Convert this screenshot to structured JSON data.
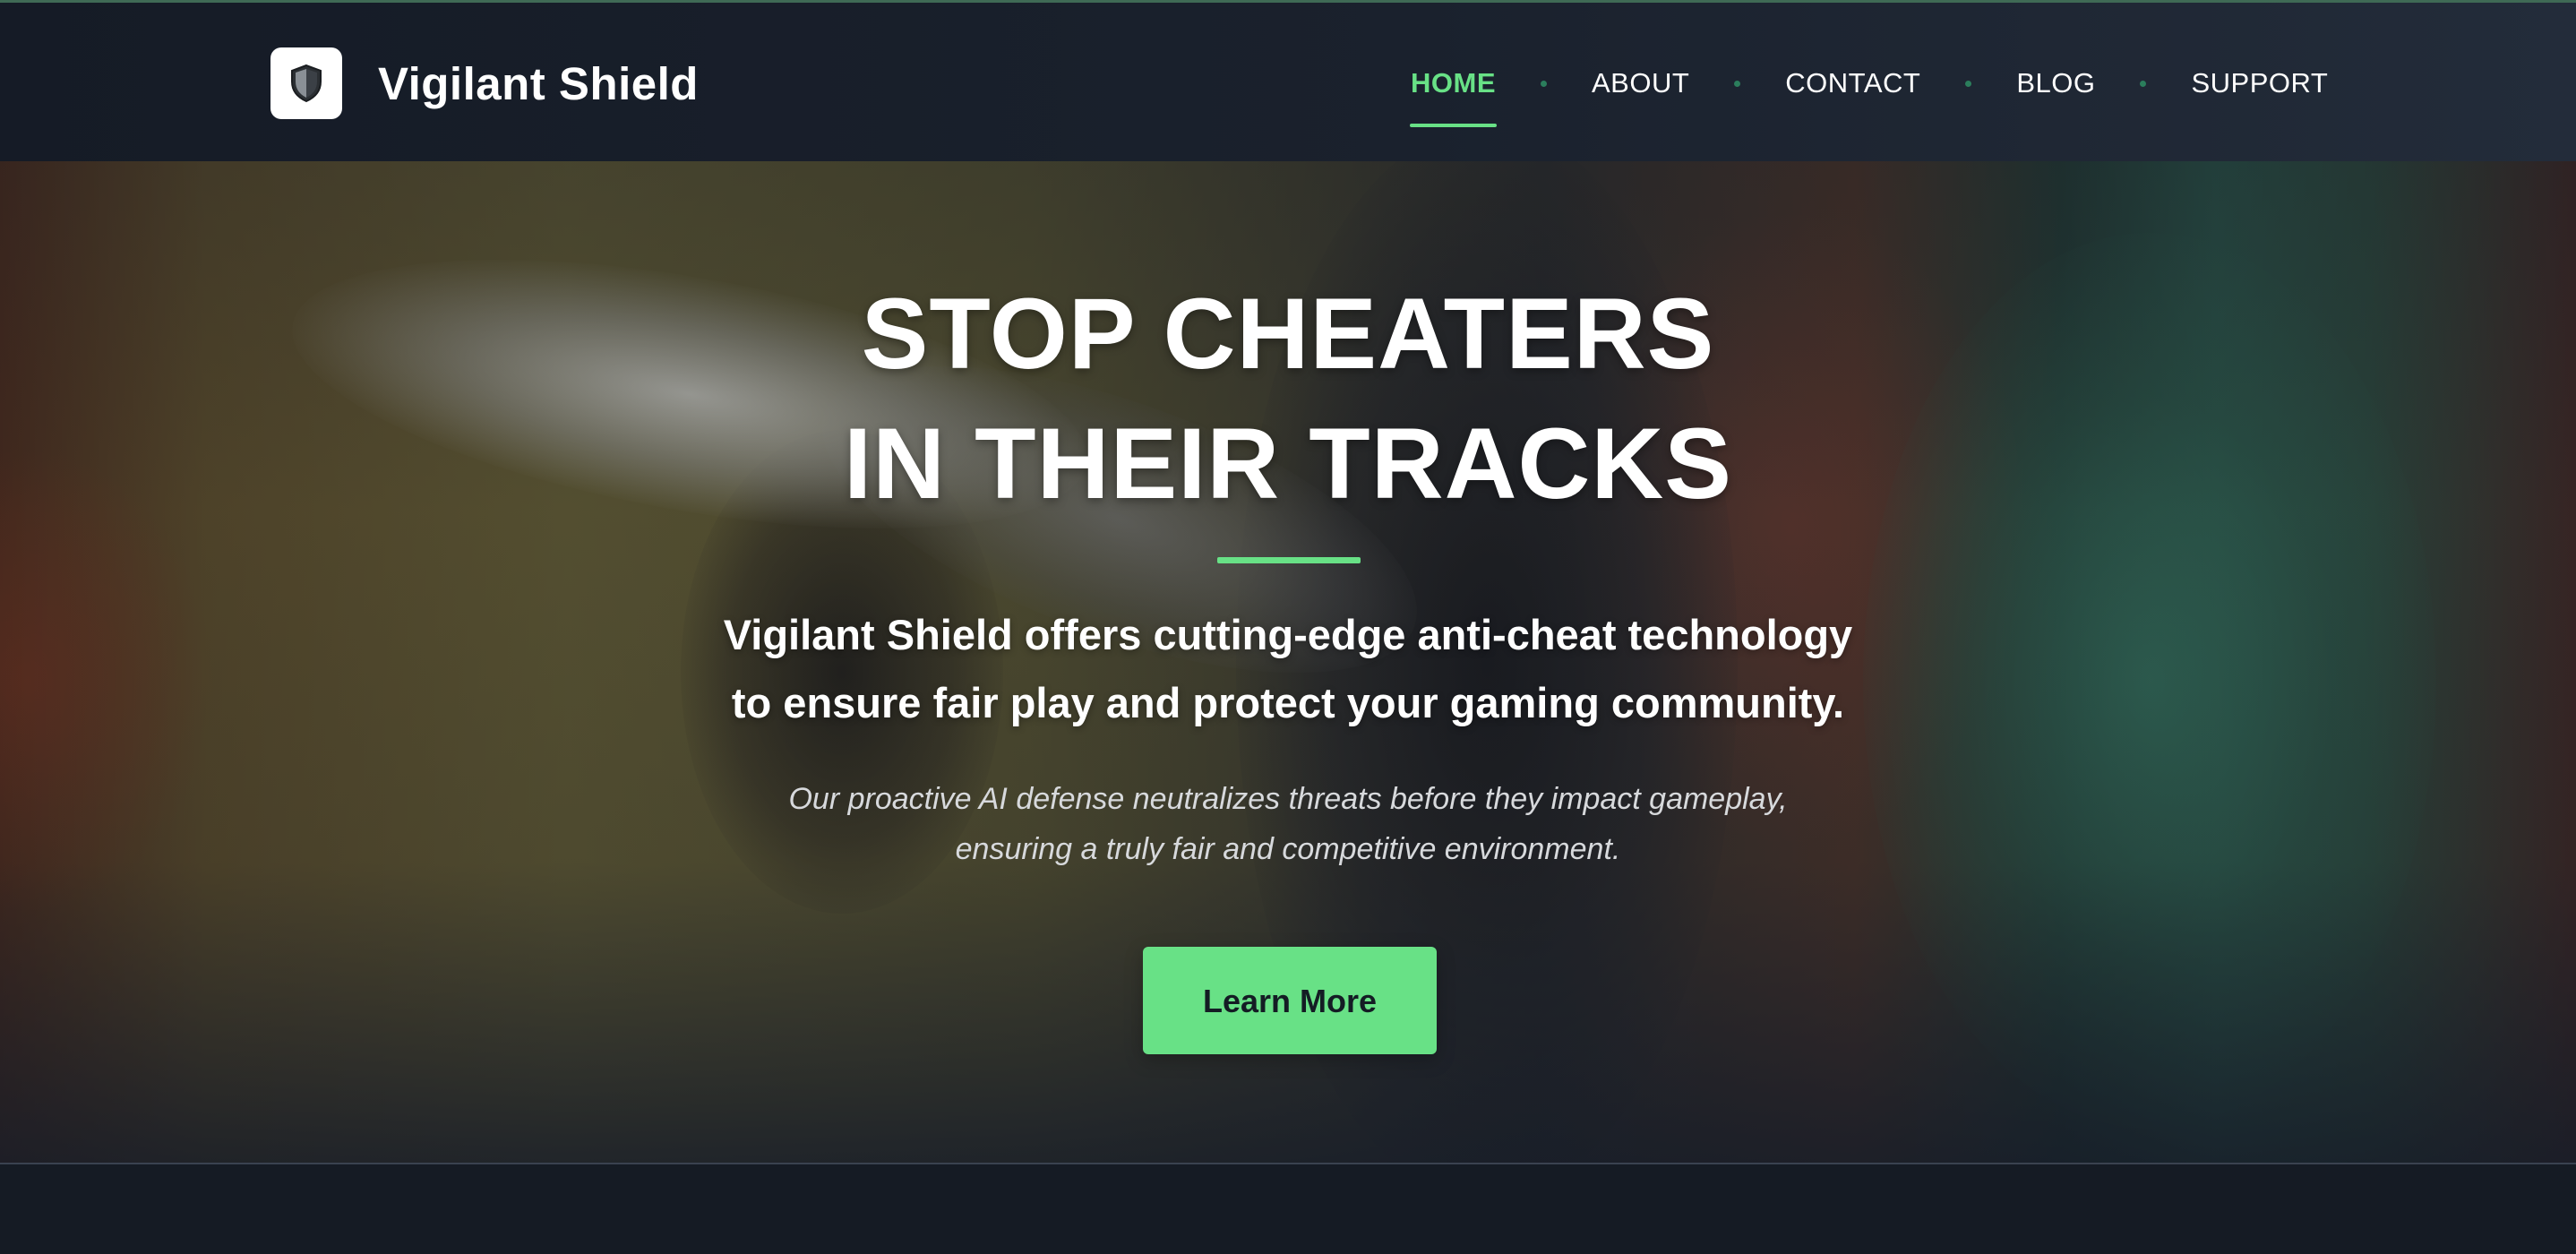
{
  "brand": {
    "name": "Vigilant Shield",
    "logo_icon": "shield-icon"
  },
  "nav": {
    "items": [
      {
        "label": "HOME",
        "active": true
      },
      {
        "label": "ABOUT",
        "active": false
      },
      {
        "label": "CONTACT",
        "active": false
      },
      {
        "label": "BLOG",
        "active": false
      },
      {
        "label": "SUPPORT",
        "active": false
      }
    ]
  },
  "hero": {
    "headline_line1": "STOP CHEATERS",
    "headline_line2": "IN THEIR TRACKS",
    "subheadline_line1": "Vigilant Shield offers cutting-edge anti-cheat technology",
    "subheadline_line2": "to ensure fair play and protect your gaming community.",
    "description_line1": "Our proactive AI defense neutralizes threats before they impact gameplay,",
    "description_line2": "ensuring a truly fair and competitive environment.",
    "cta_label": "Learn More"
  },
  "colors": {
    "accent": "#68e186",
    "header_bg": "#1a212d",
    "page_bg": "#151b24",
    "text_primary": "#ffffff"
  }
}
